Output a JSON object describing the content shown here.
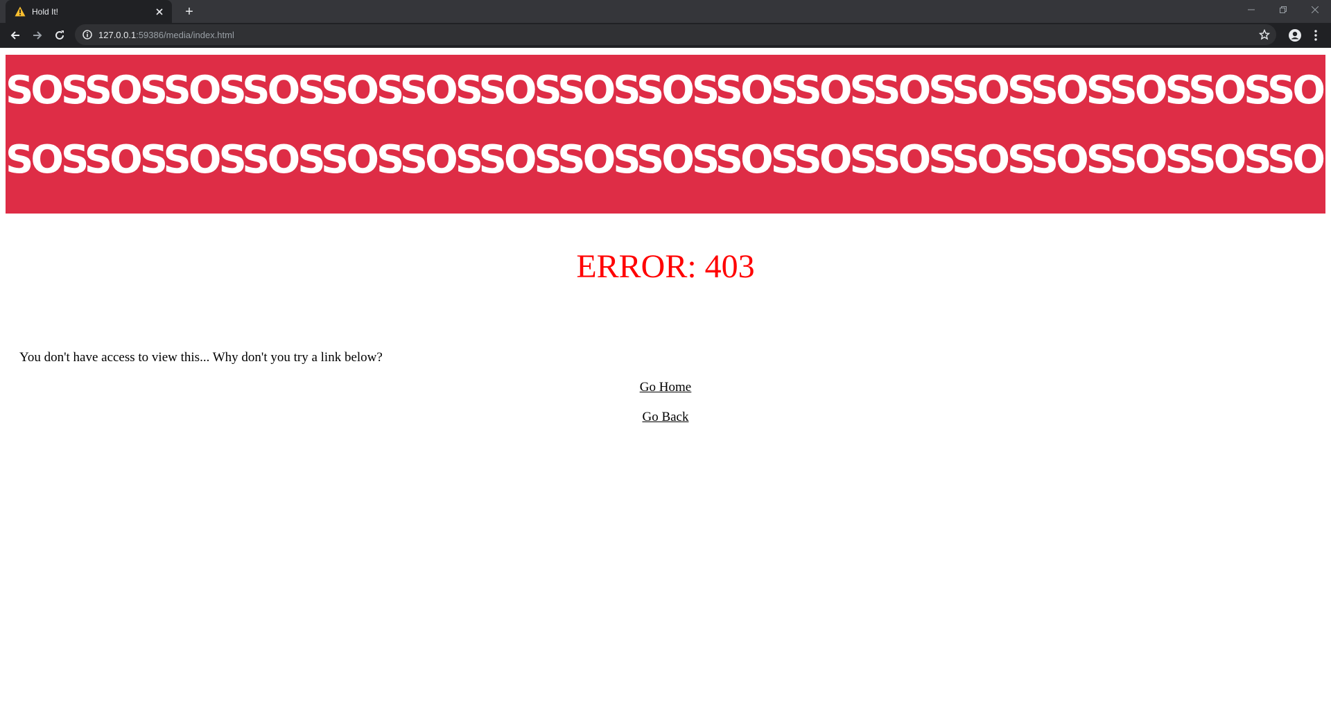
{
  "browser": {
    "tab_title": "Hold It!",
    "tab_icon": "warning-icon",
    "new_tab_label": "+",
    "url_host": "127.0.0.1",
    "url_path": ":59386/media/index.html"
  },
  "banner": {
    "background_color": "#de2d46",
    "text": "SOSSOSSOSSOSSOSSOSSOSSOSSOSSOSSOSSOSSOSSOSSOSSOSSOSSOSSOSSOSSOSSOSSOSSOSSOS"
  },
  "page": {
    "error_title": "ERROR: 403",
    "error_color": "#ff0000",
    "message": "You don't have access to view this... Why don't you try a link below?",
    "links": {
      "home": "Go Home",
      "back": "Go Back"
    }
  }
}
